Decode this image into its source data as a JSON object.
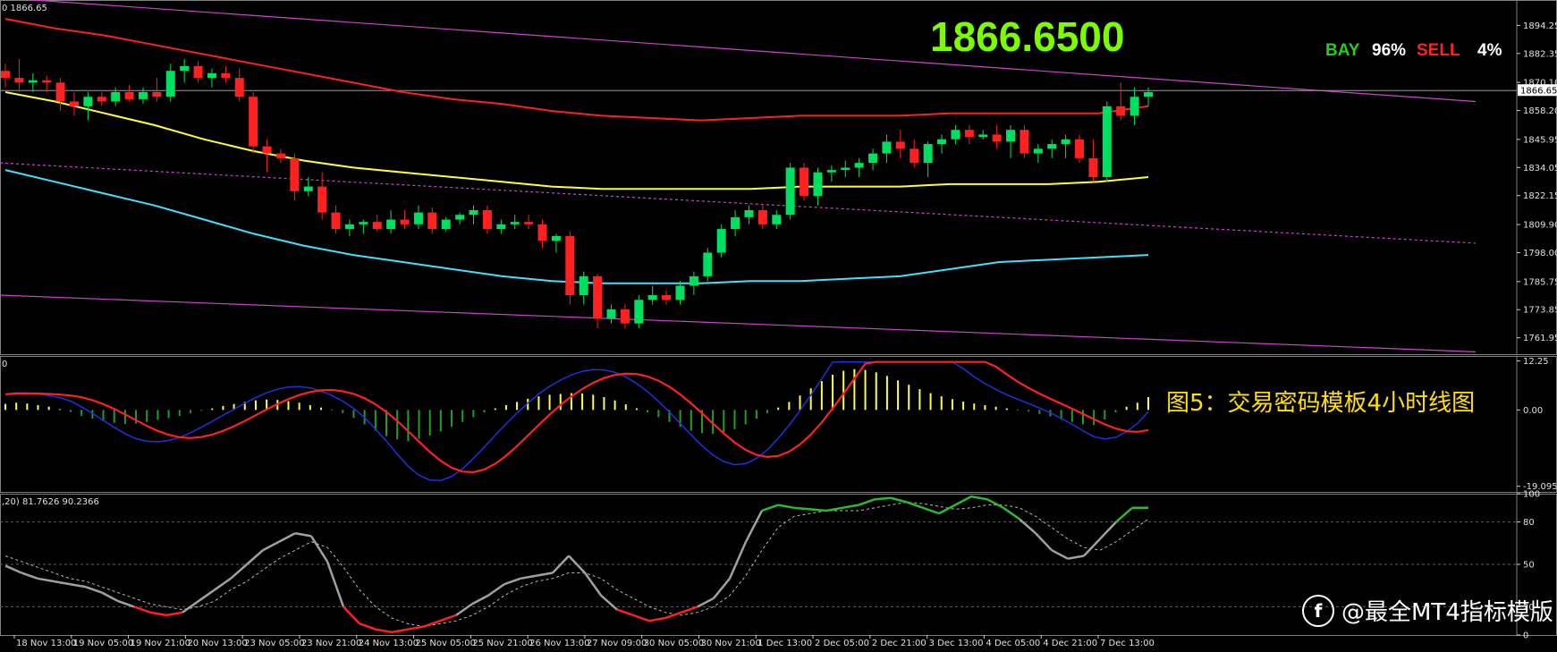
{
  "overlay": {
    "big_price": "1866.6500",
    "signals": [
      {
        "label": "BAY",
        "color": "#22CC22"
      },
      {
        "label": "96%",
        "color": "#FFFFFF"
      },
      {
        "label": "SELL",
        "color": "#FF2020"
      },
      {
        "label": "4%",
        "color": "#FFFFFF"
      }
    ],
    "caption": "图5：交易密码模板4小时线图",
    "watermark": "@最全MT4指标模版",
    "watermark_logo": "f"
  },
  "chart_data": [
    {
      "type": "candlestick",
      "header": "0 1866.65",
      "current_price_label": "1866.65",
      "ylim": [
        1755,
        1905
      ],
      "y_ticks": [
        "1894.25",
        "1882.35",
        "1870.10",
        "1858.20",
        "1845.95",
        "1834.05",
        "1822.15",
        "1809.90",
        "1798.00",
        "1785.75",
        "1773.85",
        "1761.95"
      ],
      "candles": [
        [
          1875,
          1878,
          1868,
          1872
        ],
        [
          1872,
          1880,
          1866,
          1870
        ],
        [
          1870,
          1874,
          1866,
          1871
        ],
        [
          1871,
          1873,
          1866,
          1870
        ],
        [
          1870,
          1872,
          1858,
          1862
        ],
        [
          1862,
          1866,
          1856,
          1860
        ],
        [
          1860,
          1866,
          1854,
          1864
        ],
        [
          1864,
          1866,
          1860,
          1862
        ],
        [
          1862,
          1868,
          1860,
          1866
        ],
        [
          1866,
          1869,
          1862,
          1863
        ],
        [
          1863,
          1868,
          1861,
          1866
        ],
        [
          1866,
          1872,
          1862,
          1864
        ],
        [
          1864,
          1878,
          1862,
          1875
        ],
        [
          1875,
          1880,
          1870,
          1877
        ],
        [
          1877,
          1879,
          1870,
          1872
        ],
        [
          1872,
          1876,
          1868,
          1874
        ],
        [
          1874,
          1877,
          1870,
          1872
        ],
        [
          1872,
          1876,
          1862,
          1864
        ],
        [
          1864,
          1866,
          1840,
          1843
        ],
        [
          1843,
          1846,
          1832,
          1840
        ],
        [
          1840,
          1842,
          1836,
          1838
        ],
        [
          1838,
          1840,
          1820,
          1824
        ],
        [
          1824,
          1830,
          1822,
          1826
        ],
        [
          1826,
          1832,
          1812,
          1815
        ],
        [
          1815,
          1818,
          1806,
          1808
        ],
        [
          1808,
          1812,
          1805,
          1810
        ],
        [
          1810,
          1812,
          1806,
          1811
        ],
        [
          1811,
          1814,
          1807,
          1808
        ],
        [
          1808,
          1816,
          1806,
          1812
        ],
        [
          1812,
          1816,
          1808,
          1810
        ],
        [
          1810,
          1818,
          1808,
          1815
        ],
        [
          1815,
          1817,
          1806,
          1808
        ],
        [
          1808,
          1813,
          1807,
          1812
        ],
        [
          1812,
          1815,
          1810,
          1814
        ],
        [
          1814,
          1818,
          1810,
          1816
        ],
        [
          1816,
          1818,
          1806,
          1808
        ],
        [
          1808,
          1812,
          1806,
          1810
        ],
        [
          1810,
          1814,
          1808,
          1811
        ],
        [
          1811,
          1814,
          1808,
          1810
        ],
        [
          1810,
          1812,
          1800,
          1803
        ],
        [
          1803,
          1806,
          1798,
          1805
        ],
        [
          1805,
          1807,
          1776,
          1780
        ],
        [
          1780,
          1790,
          1776,
          1788
        ],
        [
          1788,
          1789,
          1766,
          1770
        ],
        [
          1770,
          1776,
          1768,
          1774
        ],
        [
          1774,
          1776,
          1766,
          1768
        ],
        [
          1768,
          1780,
          1766,
          1778
        ],
        [
          1778,
          1784,
          1776,
          1780
        ],
        [
          1780,
          1782,
          1776,
          1778
        ],
        [
          1778,
          1786,
          1776,
          1784
        ],
        [
          1784,
          1790,
          1780,
          1788
        ],
        [
          1788,
          1800,
          1786,
          1798
        ],
        [
          1798,
          1810,
          1796,
          1808
        ],
        [
          1808,
          1816,
          1805,
          1813
        ],
        [
          1813,
          1818,
          1810,
          1816
        ],
        [
          1816,
          1818,
          1808,
          1810
        ],
        [
          1810,
          1816,
          1808,
          1814
        ],
        [
          1814,
          1836,
          1812,
          1834
        ],
        [
          1834,
          1836,
          1820,
          1822
        ],
        [
          1822,
          1834,
          1818,
          1832
        ],
        [
          1832,
          1835,
          1828,
          1833
        ],
        [
          1833,
          1837,
          1830,
          1834
        ],
        [
          1834,
          1838,
          1830,
          1836
        ],
        [
          1836,
          1842,
          1833,
          1840
        ],
        [
          1840,
          1848,
          1836,
          1845
        ],
        [
          1845,
          1850,
          1838,
          1842
        ],
        [
          1842,
          1846,
          1834,
          1836
        ],
        [
          1836,
          1845,
          1830,
          1844
        ],
        [
          1844,
          1848,
          1840,
          1846
        ],
        [
          1846,
          1852,
          1844,
          1850
        ],
        [
          1850,
          1852,
          1844,
          1847
        ],
        [
          1847,
          1850,
          1846,
          1848
        ],
        [
          1848,
          1852,
          1842,
          1845
        ],
        [
          1845,
          1852,
          1838,
          1850
        ],
        [
          1850,
          1852,
          1838,
          1840
        ],
        [
          1840,
          1844,
          1836,
          1842
        ],
        [
          1842,
          1846,
          1838,
          1844
        ],
        [
          1844,
          1848,
          1838,
          1846
        ],
        [
          1846,
          1848,
          1836,
          1838
        ],
        [
          1838,
          1846,
          1828,
          1830
        ],
        [
          1830,
          1862,
          1828,
          1860
        ],
        [
          1860,
          1870,
          1854,
          1856
        ],
        [
          1856,
          1868,
          1852,
          1864
        ],
        [
          1864,
          1868,
          1860,
          1866
        ]
      ],
      "moving_averages": [
        {
          "color": "#FF2020",
          "values": [
            1897,
            1893,
            1890,
            1886,
            1882,
            1878,
            1874,
            1870,
            1866,
            1863,
            1861,
            1858,
            1856,
            1855,
            1854,
            1855,
            1856,
            1856,
            1856,
            1857,
            1857,
            1857,
            1857,
            1860
          ]
        },
        {
          "color": "#FFFF30",
          "values": [
            1866,
            1862,
            1857,
            1852,
            1846,
            1841,
            1837,
            1834,
            1832,
            1830,
            1828,
            1826,
            1825,
            1825,
            1825,
            1825,
            1826,
            1826,
            1826,
            1827,
            1827,
            1827,
            1828,
            1830
          ]
        },
        {
          "color": "#40E0FF",
          "values": [
            1833,
            1828,
            1823,
            1818,
            1812,
            1806,
            1801,
            1797,
            1794,
            1791,
            1788,
            1786,
            1785,
            1785,
            1785,
            1786,
            1786,
            1787,
            1788,
            1791,
            1794,
            1795,
            1796,
            1797
          ]
        }
      ],
      "channel_lines": [
        {
          "color": "#CC44CC",
          "style": "solid",
          "from": 1906,
          "to": 1862
        },
        {
          "color": "#CC44CC",
          "style": "dashed",
          "from": 1836,
          "to": 1802
        },
        {
          "color": "#CC44CC",
          "style": "solid",
          "from": 1780,
          "to": 1756
        }
      ]
    },
    {
      "type": "macd",
      "header": "0",
      "ylim": [
        -20.5,
        13.5
      ],
      "y_ticks": [
        "12.25",
        "0.00",
        "-19.095"
      ],
      "histogram": [
        1.5,
        1.8,
        1.6,
        1.2,
        0.8,
        0.2,
        -0.5,
        -1.5,
        -2.2,
        -2.8,
        -3.2,
        -3.5,
        -3.4,
        -3.0,
        -2.5,
        -2.0,
        -1.5,
        -0.8,
        -0.2,
        0.4,
        1.0,
        1.5,
        2.0,
        2.4,
        2.6,
        2.5,
        2.2,
        1.8,
        1.2,
        0.6,
        0.1,
        -0.8,
        -2.0,
        -3.6,
        -5.2,
        -6.5,
        -7.4,
        -7.8,
        -7.2,
        -6.4,
        -5.4,
        -4.2,
        -3.0,
        -1.8,
        -0.6,
        0.4,
        1.2,
        2.0,
        2.8,
        3.4,
        3.8,
        4.0,
        4.2,
        4.1,
        3.8,
        3.2,
        2.4,
        1.4,
        0.4,
        -0.6,
        -1.8,
        -3.0,
        -4.2,
        -5.2,
        -5.8,
        -6.0,
        -5.6,
        -4.8,
        -3.6,
        -2.2,
        -0.8,
        0.6,
        2.0,
        3.6,
        5.4,
        7.2,
        8.8,
        9.8,
        10.2,
        10.0,
        9.4,
        8.5,
        7.4,
        6.3,
        5.2,
        4.2,
        3.4,
        2.7,
        2.1,
        1.6,
        1.2,
        0.8,
        0.4,
        0.1,
        -0.4,
        -1.0,
        -1.6,
        -2.4,
        -3.0,
        -3.6,
        -3.8,
        -2.4,
        -0.6,
        0.8,
        1.8,
        3.2
      ]
    },
    {
      "type": "stochastic",
      "header": ",20) 81.7626 90.2366",
      "ylim": [
        0,
        100
      ],
      "y_ticks": [
        "100",
        "80",
        "50",
        "20",
        "0"
      ],
      "k": [
        49,
        44,
        40,
        38,
        36,
        34,
        30,
        24,
        20,
        16,
        14,
        16,
        24,
        32,
        40,
        50,
        60,
        66,
        72,
        70,
        52,
        20,
        8,
        4,
        2,
        4,
        6,
        10,
        14,
        22,
        28,
        36,
        40,
        42,
        44,
        56,
        44,
        28,
        18,
        14,
        10,
        12,
        16,
        20,
        26,
        40,
        66,
        88,
        92,
        90,
        89,
        88,
        90,
        92,
        96,
        97,
        94,
        90,
        86,
        92,
        98,
        96,
        90,
        82,
        72,
        60,
        54,
        56,
        68,
        80,
        90,
        90
      ],
      "d": [
        56,
        52,
        48,
        44,
        40,
        38,
        34,
        30,
        26,
        22,
        20,
        18,
        20,
        24,
        32,
        38,
        46,
        54,
        60,
        66,
        62,
        48,
        32,
        20,
        12,
        8,
        6,
        8,
        10,
        14,
        20,
        28,
        34,
        38,
        40,
        44,
        44,
        40,
        32,
        26,
        20,
        16,
        14,
        16,
        20,
        28,
        42,
        60,
        76,
        84,
        86,
        88,
        88,
        88,
        90,
        92,
        94,
        93,
        91,
        89,
        90,
        92,
        92,
        90,
        84,
        76,
        68,
        62,
        60,
        66,
        74,
        82
      ]
    }
  ],
  "x_axis": {
    "labels": [
      "18 Nov 13:00",
      "19 Nov 05:00",
      "19 Nov 21:00",
      "20 Nov 13:00",
      "23 Nov 05:00",
      "23 Nov 21:00",
      "24 Nov 13:00",
      "25 Nov 05:00",
      "25 Nov 21:00",
      "26 Nov 13:00",
      "27 Nov 09:00",
      "30 Nov 05:00",
      "30 Nov 21:00",
      "1 Dec 13:00",
      "2 Dec 05:00",
      "2 Dec 21:00",
      "3 Dec 13:00",
      "4 Dec 05:00",
      "4 Dec 21:00",
      "7 Dec 13:00"
    ]
  }
}
